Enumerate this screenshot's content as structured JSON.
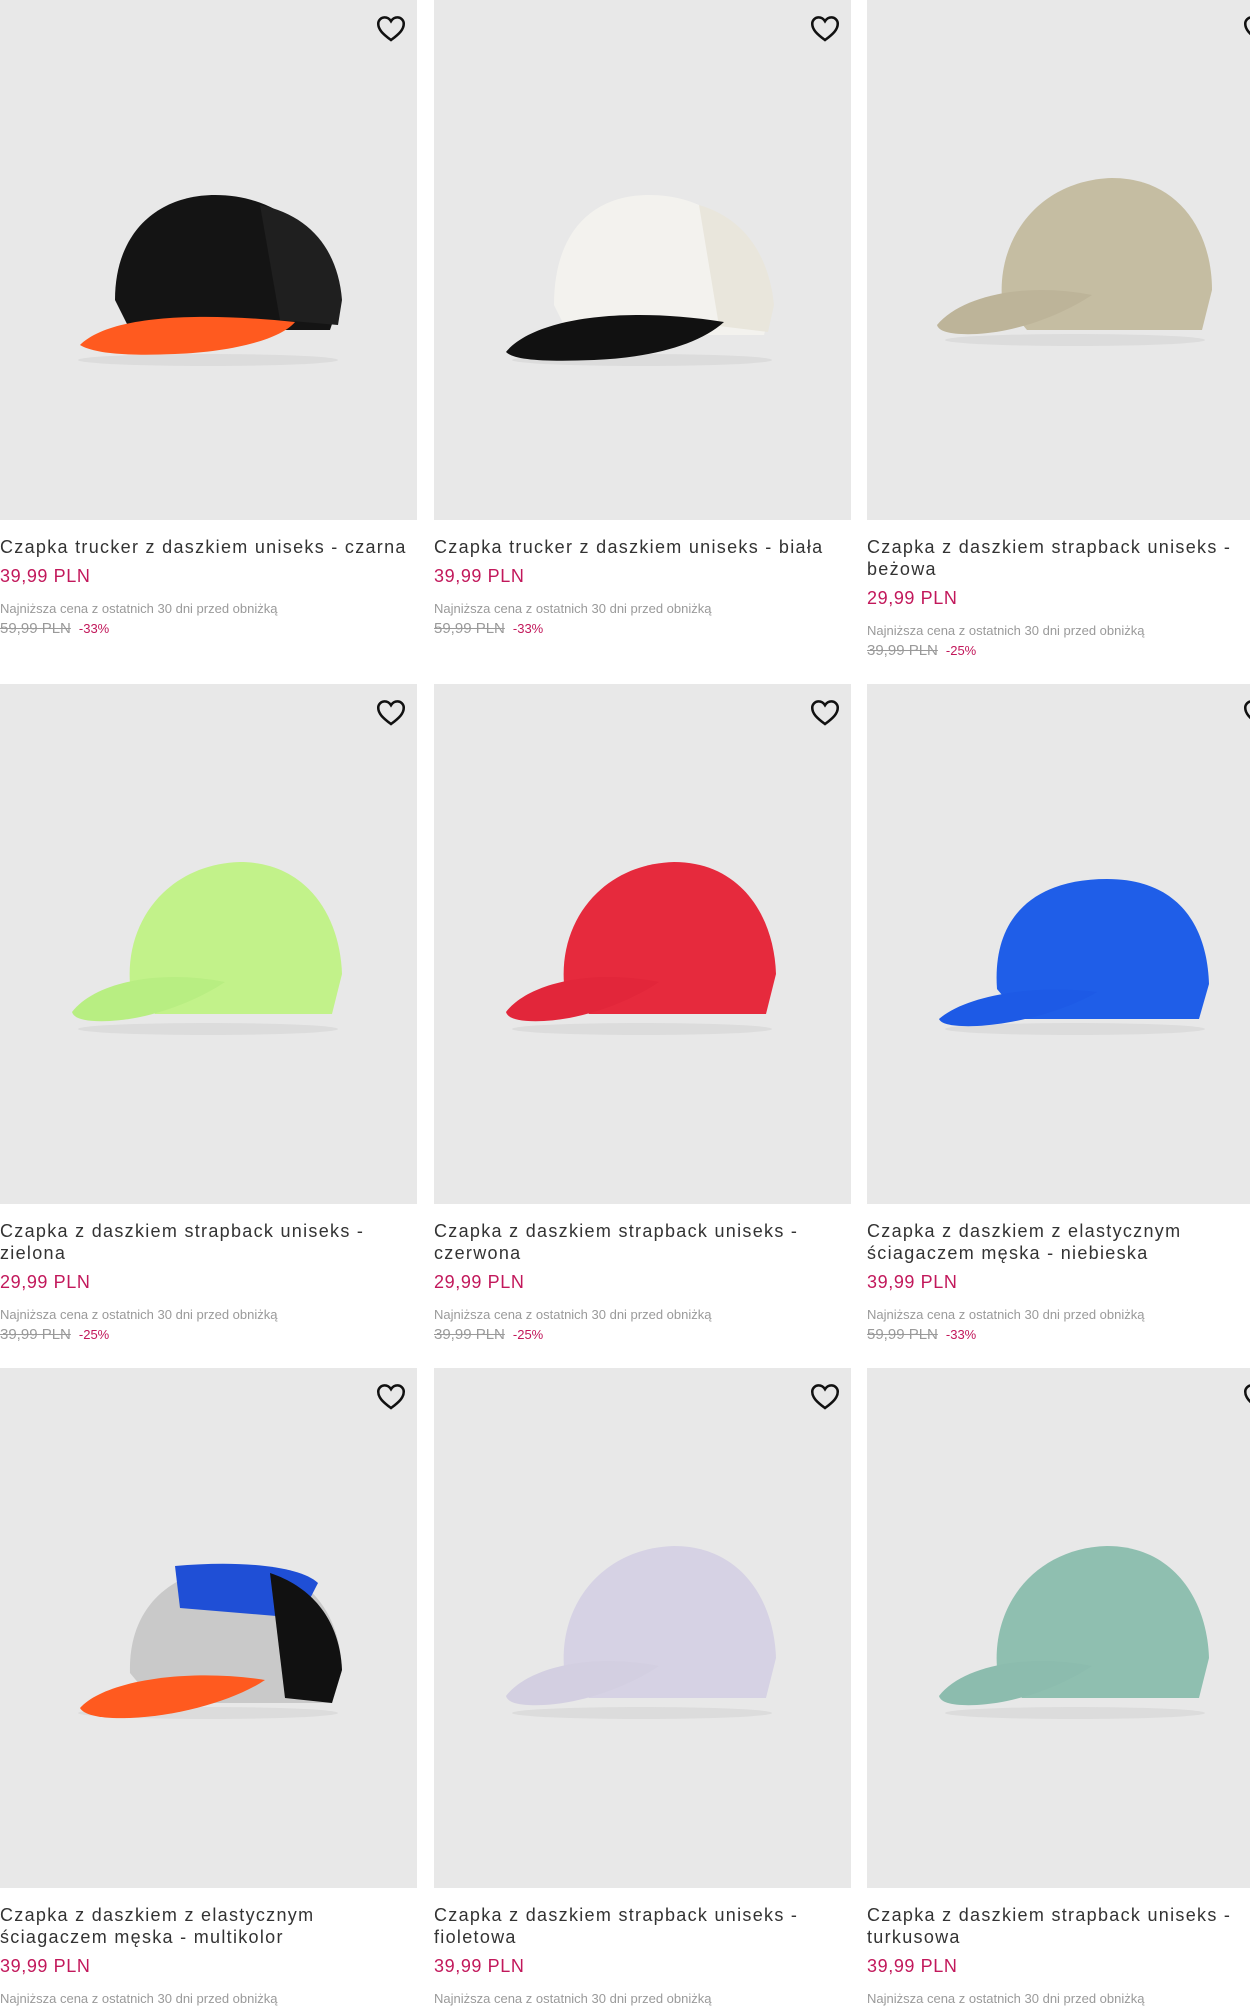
{
  "products": [
    {
      "title": "Czapka trucker z daszkiem uniseks - czarna",
      "price": "39,99 PLN",
      "lowest_label": "Najniższa cena z ostatnich 30 dni przed obniżką",
      "old_price": "59,99 PLN",
      "discount": "-33%",
      "colors": {
        "crown": "#141414",
        "mesh": "#1f1f1f",
        "visor": "#ff5a1f"
      }
    },
    {
      "title": "Czapka trucker z daszkiem uniseks - biała",
      "price": "39,99 PLN",
      "lowest_label": "Najniższa cena z ostatnich 30 dni przed obniżką",
      "old_price": "59,99 PLN",
      "discount": "-33%",
      "colors": {
        "crown": "#f3f2ee",
        "mesh": "#e9e6dc",
        "visor": "#111111"
      }
    },
    {
      "title": "Czapka z daszkiem strapback uniseks - beżowa",
      "price": "29,99 PLN",
      "lowest_label": "Najniższa cena z ostatnich 30 dni przed obniżką",
      "old_price": "39,99 PLN",
      "discount": "-25%",
      "colors": {
        "crown": "#c5bda2",
        "mesh": "#b9b194",
        "visor": "#bdb499"
      }
    },
    {
      "title": "Czapka z daszkiem strapback uniseks - zielona",
      "price": "29,99 PLN",
      "lowest_label": "Najniższa cena z ostatnich 30 dni przed obniżką",
      "old_price": "39,99 PLN",
      "discount": "-25%",
      "colors": {
        "crown": "#c2f28a",
        "mesh": "#b5e77f",
        "visor": "#b8ee82"
      }
    },
    {
      "title": "Czapka z daszkiem strapback uniseks - czerwona",
      "price": "29,99 PLN",
      "lowest_label": "Najniższa cena z ostatnich 30 dni przed obniżką",
      "old_price": "39,99 PLN",
      "discount": "-25%",
      "colors": {
        "crown": "#e62a3d",
        "mesh": "#d41f32",
        "visor": "#e2263a"
      }
    },
    {
      "title": "Czapka z daszkiem z elastycznym ściagaczem męska - niebieska",
      "price": "39,99 PLN",
      "lowest_label": "Najniższa cena z ostatnich 30 dni przed obniżką",
      "old_price": "59,99 PLN",
      "discount": "-33%",
      "colors": {
        "crown": "#1f5ee8",
        "mesh": "#1a52d6",
        "visor": "#1d5ae6"
      }
    },
    {
      "title": "Czapka z daszkiem z elastycznym ściagaczem męska - multikolor",
      "price": "39,99 PLN",
      "lowest_label": "Najniższa cena z ostatnich 30 dni przed obniżką",
      "colors": {
        "crown": "#c9c9c9",
        "mesh": "#111111",
        "visor": "#ff5a1f",
        "top": "#1f4fd6"
      }
    },
    {
      "title": "Czapka z daszkiem strapback uniseks - fioletowa",
      "price": "39,99 PLN",
      "lowest_label": "Najniższa cena z ostatnich 30 dni przed obniżką",
      "colors": {
        "crown": "#d6d2e4",
        "mesh": "#cbc6dc",
        "visor": "#d3cfe1"
      }
    },
    {
      "title": "Czapka z daszkiem strapback uniseks - turkusowa",
      "price": "39,99 PLN",
      "lowest_label": "Najniższa cena z ostatnich 30 dni przed obniżką",
      "colors": {
        "crown": "#8fbfb0",
        "mesh": "#82b2a3",
        "visor": "#8cbcae"
      }
    }
  ],
  "icons": {
    "wishlist": "heart-outline-icon"
  },
  "accent": "#c2185b"
}
